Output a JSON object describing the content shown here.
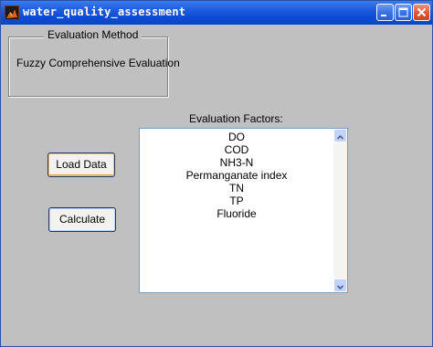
{
  "window": {
    "title": "water_quality_assessment",
    "icons": {
      "app": "matlab-logo-icon",
      "minimize": "minimize-icon",
      "maximize": "maximize-icon",
      "close": "close-icon"
    }
  },
  "evaluation_method": {
    "group_title": "Evaluation Method",
    "value": "Fuzzy Comprehensive Evaluation"
  },
  "buttons": {
    "load_label": "Load Data",
    "calculate_label": "Calculate"
  },
  "factors": {
    "label": "Evaluation Factors:",
    "items": [
      "DO",
      "COD",
      "NH3-N",
      "Permanganate index",
      "TN",
      "TP",
      "Fluoride"
    ],
    "scroll_icons": [
      "chevron-up-icon",
      "chevron-down-icon"
    ]
  },
  "colors": {
    "titlebar": "#0b4bd2",
    "client_background": "#c0c0c0",
    "button_hover_accent": "#e8a33a"
  }
}
